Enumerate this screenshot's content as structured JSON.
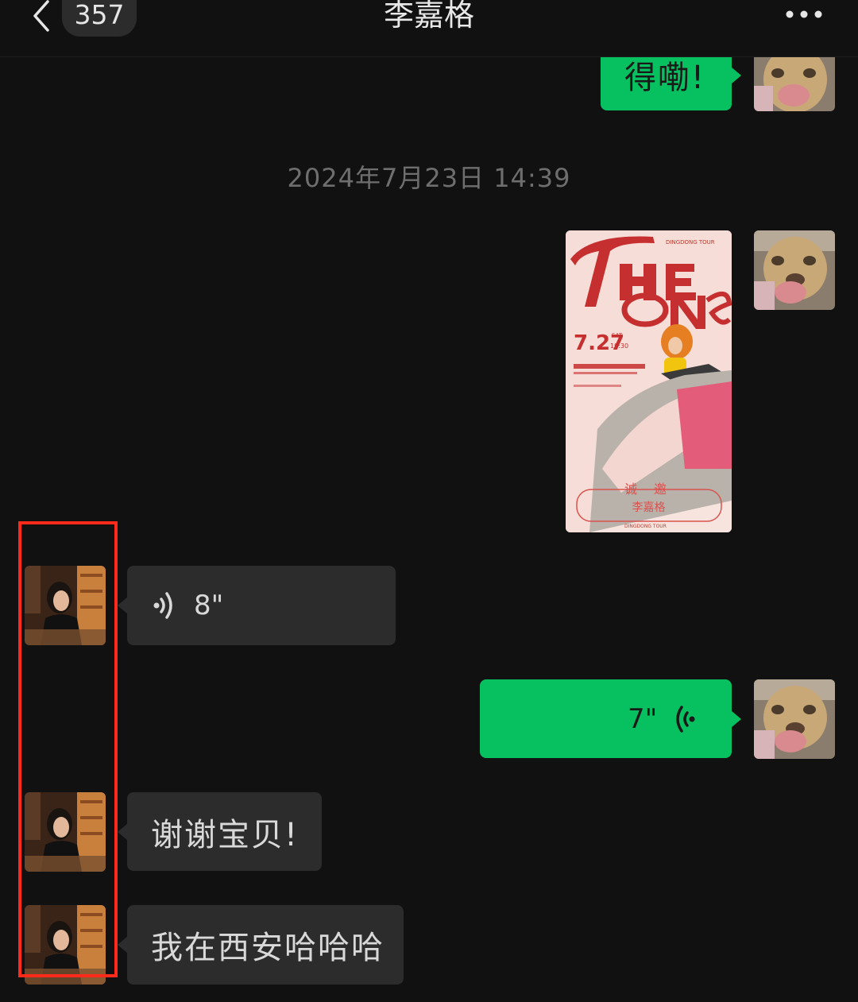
{
  "header": {
    "unread_count": "357",
    "title": "李嘉格"
  },
  "timestamp": "2024年7月23日 14:39",
  "messages": {
    "m1_text": "得嘞!",
    "poster": {
      "invite_text": "诚 邀",
      "invite_name": "李嘉格"
    },
    "m3_voice_duration": "8\"",
    "m4_voice_duration": "7\"",
    "m5_text": "谢谢宝贝!",
    "m6_text": "我在西安哈哈哈"
  },
  "colors": {
    "background": "#111111",
    "sent_bubble": "#07c160",
    "received_bubble": "#2c2c2c",
    "highlight": "#ff2a1a"
  }
}
